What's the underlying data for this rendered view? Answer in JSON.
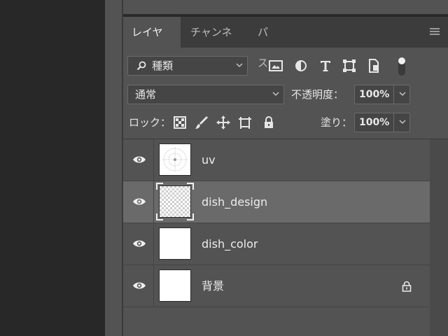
{
  "tabs": [
    {
      "label": "レイヤー"
    },
    {
      "label": "チャンネル"
    },
    {
      "label": "パス"
    }
  ],
  "filter": {
    "label": "種類"
  },
  "blend_mode": {
    "value": "通常"
  },
  "opacity": {
    "label": "不透明度：",
    "value": "100%"
  },
  "lock": {
    "label": "ロック："
  },
  "fill": {
    "label": "塗り：",
    "value": "100%"
  },
  "layers": [
    {
      "name": "uv",
      "selected": false,
      "locked": false,
      "visible": true
    },
    {
      "name": "dish_design",
      "selected": true,
      "locked": false,
      "visible": true
    },
    {
      "name": "dish_color",
      "selected": false,
      "locked": false,
      "visible": true
    },
    {
      "name": "背景",
      "selected": false,
      "locked": true,
      "visible": true
    }
  ],
  "icons": {
    "filter_types": [
      "image-filter-icon",
      "adjustment-filter-icon",
      "type-filter-icon",
      "shape-filter-icon",
      "smart-object-filter-icon"
    ],
    "lock_types": [
      "lock-transparent-pixels-icon",
      "lock-image-pixels-icon",
      "lock-position-icon",
      "lock-artboard-icon",
      "lock-all-icon"
    ]
  },
  "colors": {
    "panel_bg": "#535353",
    "tab_bar_bg": "#3c3c3c",
    "selected_row": "#6a6a6a",
    "workspace": "#282828"
  }
}
